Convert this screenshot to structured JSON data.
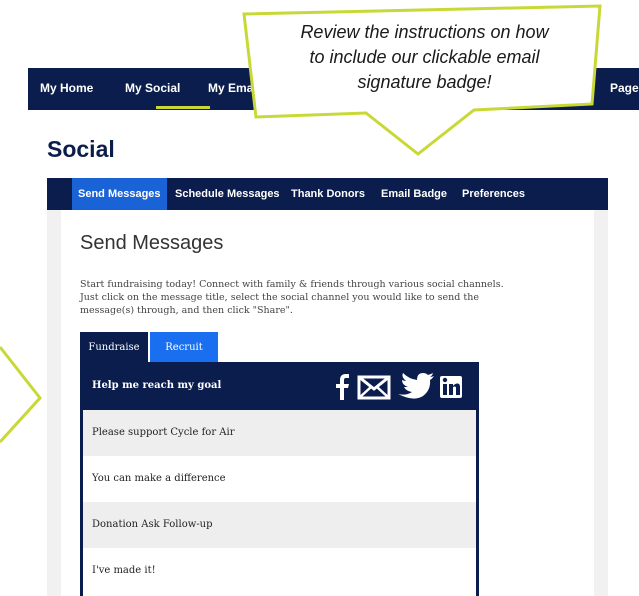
{
  "top_nav": {
    "items": [
      "My Home",
      "My Social",
      "My Email",
      "Page"
    ],
    "active": "My Social"
  },
  "callout": {
    "line1": "Review the instructions on how",
    "line2": "to include our clickable email",
    "line3": "signature badge!"
  },
  "page_title": "Social",
  "sub_nav": {
    "tabs": [
      "Send Messages",
      "Schedule Messages",
      "Thank Donors",
      "Email Badge",
      "Preferences"
    ],
    "active": "Send Messages"
  },
  "content": {
    "title": "Send Messages",
    "intro_line1": "Start fundraising today! Connect with family & friends through various social channels.",
    "intro_line2": "Just click on the message title, select the social channel you would like to send the",
    "intro_line3": "message(s) through, and then click \"Share\"."
  },
  "message_tabs": {
    "fundraise": "Fundraise",
    "recruit": "Recruit"
  },
  "message_box": {
    "header": "Help me reach my goal",
    "icons": [
      "facebook-icon",
      "email-icon",
      "twitter-icon",
      "linkedin-icon"
    ],
    "messages": [
      "Please support Cycle for Air",
      "You can make a difference",
      "Donation Ask Follow-up",
      "I've made it!"
    ]
  },
  "colors": {
    "navy": "#0b1d4d",
    "accent_green": "#c8d937",
    "active_blue": "#1a63d6"
  }
}
